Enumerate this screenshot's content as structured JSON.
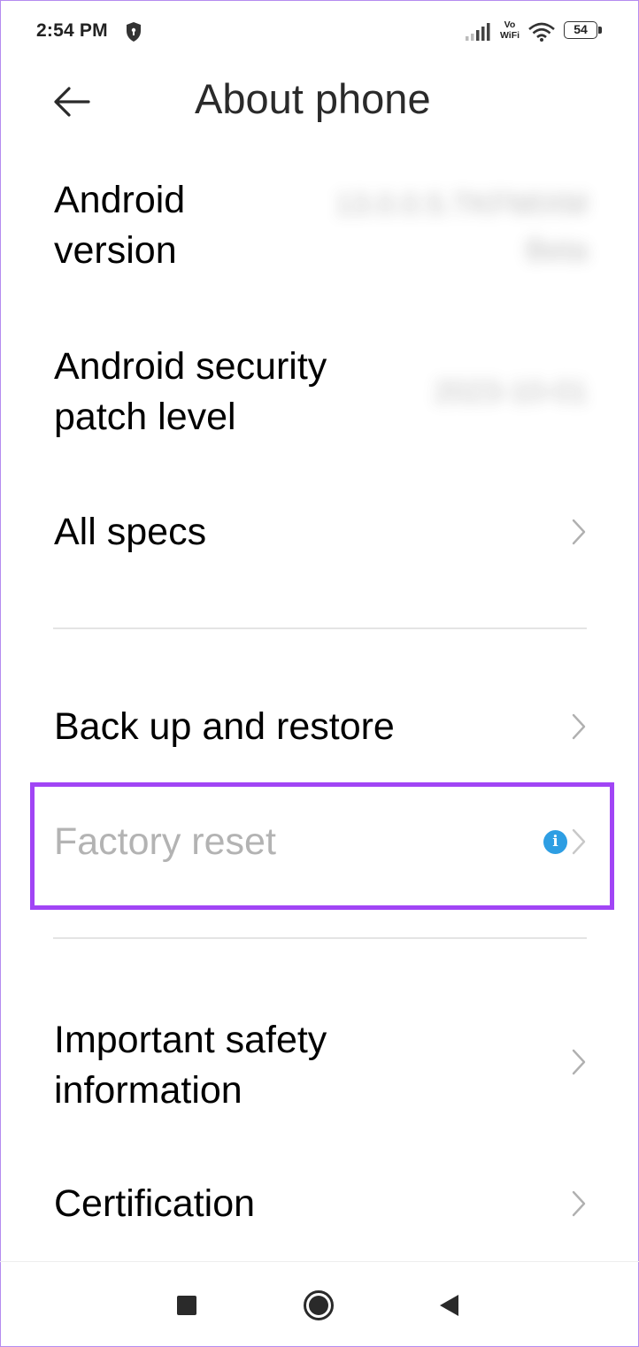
{
  "status_bar": {
    "time": "2:54 PM",
    "vowifi_top": "Vo",
    "vowifi_bottom": "WiFi",
    "battery": "54",
    "icons": [
      "shield-icon",
      "signal-icon",
      "vowifi-icon",
      "wifi-icon",
      "battery-icon"
    ]
  },
  "header": {
    "title": "About phone",
    "back_icon": "arrow-left-icon"
  },
  "settings": {
    "android_version": {
      "label_line1": "Android",
      "label_line2": "version",
      "value_line1": "13.0.0.5.TKFMIXM",
      "value_line2": "Beta"
    },
    "security_patch": {
      "label_line1": "Android security",
      "label_line2": "patch level",
      "value": "2023-10-01"
    },
    "all_specs": {
      "label": "All specs"
    },
    "backup_restore": {
      "label": "Back up and restore"
    },
    "factory_reset": {
      "label": "Factory reset",
      "label_color": "#b3b3b3",
      "info_glyph": "i",
      "highlight_color": "#a145f5"
    },
    "safety_info": {
      "label_line1": "Important safety",
      "label_line2": "information"
    },
    "certification": {
      "label": "Certification"
    }
  },
  "nav_bar": {
    "icons": [
      "recents-square-icon",
      "home-circle-icon",
      "back-triangle-icon"
    ]
  }
}
